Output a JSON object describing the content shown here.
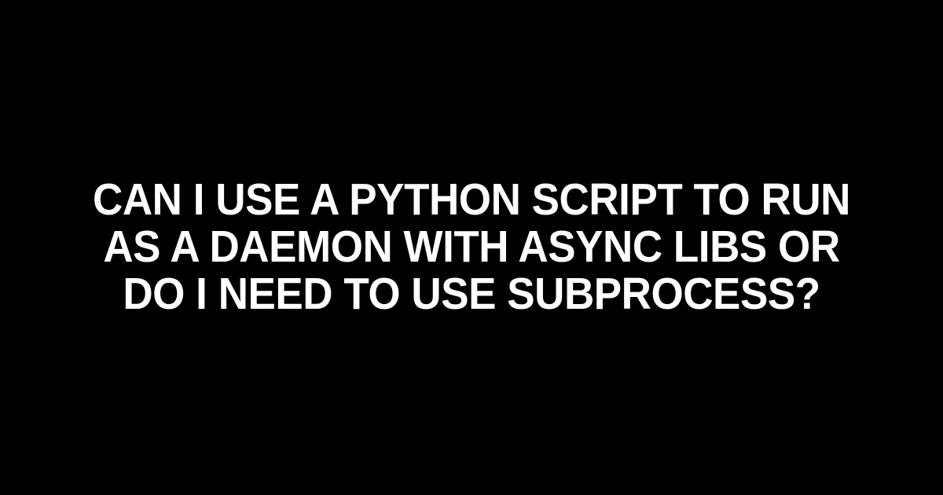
{
  "title": "Can I use a Python script to run as a daemon with async libs or do I need to use subprocess?"
}
